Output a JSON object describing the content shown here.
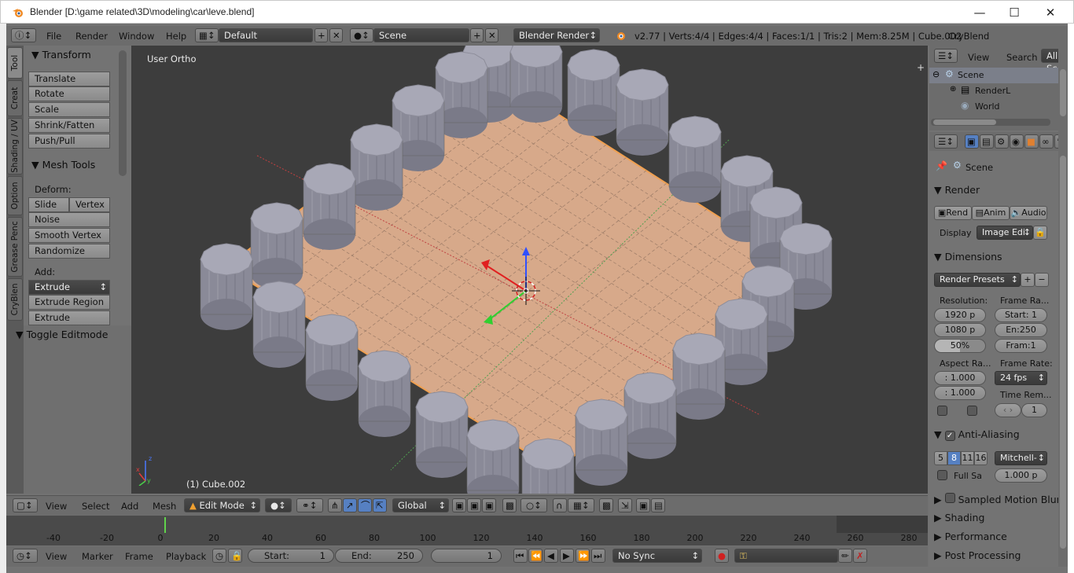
{
  "window": {
    "title": "Blender [D:\\game related\\3D\\modeling\\car\\leve.blend]"
  },
  "infobar": {
    "menus": [
      "File",
      "Render",
      "Window",
      "Help"
    ],
    "layout": "Default",
    "scene": "Scene",
    "engine": "Blender Render",
    "stats": "v2.77 | Verts:4/4 | Edges:4/4 | Faces:1/1 | Tris:2 | Mem:8.25M | Cube.002",
    "addon": "CryBlend"
  },
  "left_tabs": [
    "Tool",
    "Creat",
    "Shading / UV",
    "Option",
    "Grease Penc",
    "CryBlen"
  ],
  "tool_panel": {
    "transform_header": "Transform",
    "transform_buttons": [
      "Translate",
      "Rotate",
      "Scale",
      "Shrink/Fatten",
      "Push/Pull"
    ],
    "mesh_tools_header": "Mesh Tools",
    "deform_label": "Deform:",
    "slide_edge": "Slide Ed",
    "vertex": "Vertex",
    "deform_buttons": [
      "Noise",
      "Smooth Vertex",
      "Randomize"
    ],
    "add_label": "Add:",
    "extrude": "Extrude",
    "add_buttons": [
      "Extrude Region",
      "Extrude Individual"
    ],
    "toggle_editmode": "Toggle Editmode"
  },
  "viewport": {
    "view_label": "User Ortho",
    "object_label": "(1) Cube.002"
  },
  "view3d_header": {
    "menus": [
      "View",
      "Select",
      "Add",
      "Mesh"
    ],
    "mode": "Edit Mode",
    "orientation": "Global"
  },
  "timeline": {
    "ticks": [
      "-40",
      "-20",
      "0",
      "20",
      "40",
      "60",
      "80",
      "100",
      "120",
      "140",
      "160",
      "180",
      "200",
      "220",
      "240",
      "260",
      "280"
    ]
  },
  "bottom_header": {
    "menus": [
      "View",
      "Marker",
      "Frame",
      "Playback"
    ],
    "start_label": "Start:",
    "start_value": "1",
    "end_label": "End:",
    "end_value": "250",
    "current_frame": "1",
    "sync": "No Sync"
  },
  "outliner": {
    "view": "View",
    "search": "Search",
    "filter": "All Sc",
    "items": [
      "Scene",
      "RenderL",
      "World"
    ]
  },
  "properties": {
    "context": "Scene",
    "render_header": "Render",
    "render_buttons": [
      "Rend",
      "Anim",
      "Audio"
    ],
    "display_label": "Display",
    "display_value": "Image Edi",
    "dimensions_header": "Dimensions",
    "render_presets": "Render Presets",
    "resolution_label": "Resolution:",
    "res_x": "1920 p",
    "res_y": "1080 p",
    "res_pct": "50%",
    "frame_range_label": "Frame Ra...",
    "frame_start": "Start: 1",
    "frame_end": "En:250",
    "frame_step": "Fram:1",
    "aspect_label": "Aspect Ra...",
    "aspect_x": ": 1.000",
    "aspect_y": ": 1.000",
    "frame_rate_label": "Frame Rate:",
    "frame_rate": "24 fps",
    "time_remap_label": "Time Rem...",
    "time_remap_value": "1",
    "aa_header": "Anti-Aliasing",
    "aa_samples": [
      "5",
      "8",
      "11",
      "16"
    ],
    "aa_filter": "Mitchell-",
    "full_sample": "Full Sa",
    "filter_size": "1.000 p",
    "sampled_motion_blur": "Sampled Motion Blur",
    "shading": "Shading",
    "performance": "Performance",
    "post_processing": "Post Processing"
  },
  "colors": {
    "accent": "#5680c2",
    "plane": "#d7a98a",
    "cylinder": "#a8a8b6",
    "viewport_bg": "#3d3d3d"
  }
}
